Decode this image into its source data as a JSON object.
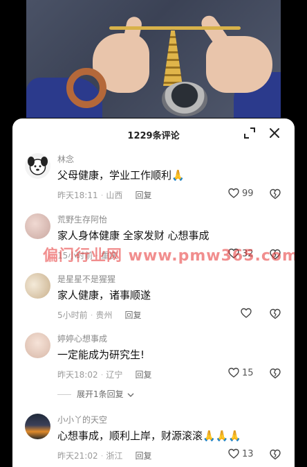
{
  "header": {
    "title": "1229条评论"
  },
  "comments": [
    {
      "name": "林念",
      "text": "父母健康，学业工作顺利",
      "emoji": "🙏",
      "time": "昨天18:11",
      "location": "山西",
      "reply_label": "回复",
      "likes": "99"
    },
    {
      "name": "荒野生存阿怡",
      "text": "家人身体健康 全家发财 心想事成",
      "emoji": "",
      "time": "15小时前",
      "location": "重庆",
      "reply_label": "回复",
      "likes": "32"
    },
    {
      "name": "是星星不是猩猩",
      "text": "家人健康，诸事顺遂",
      "emoji": "",
      "time": "5小时前",
      "location": "贵州",
      "reply_label": "回复",
      "likes": ""
    },
    {
      "name": "婷婷心想事成",
      "text": "一定能成为研究生!",
      "emoji": "",
      "time": "昨天18:02",
      "location": "辽宁",
      "reply_label": "回复",
      "likes": "15"
    },
    {
      "name": "小小丫的天空",
      "text": "心想事成，顺利上岸，财源滚滚",
      "emoji": "🙏🙏🙏",
      "time": "昨天21:02",
      "location": "浙江",
      "reply_label": "回复",
      "likes": "13"
    }
  ],
  "expand_replies": {
    "label": "展开1条回复"
  },
  "watermark": "偏门行业网 www.pmw365.com",
  "colors": {
    "accent_emoji": "#f2a23b",
    "watermark": "#e63232",
    "sleeve": "#2b3a8c"
  }
}
